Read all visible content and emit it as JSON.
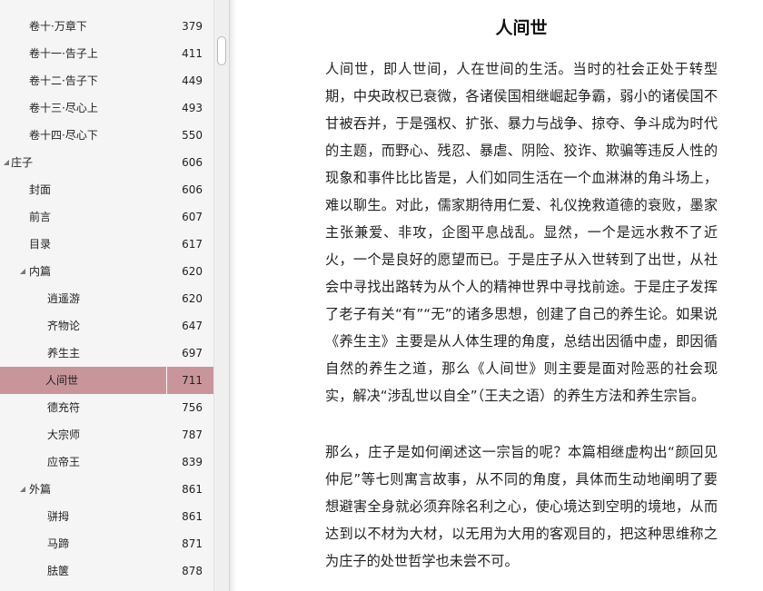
{
  "toc": {
    "items": [
      {
        "label": "卷十·万章下",
        "page": "379",
        "level": 1,
        "arrow": ""
      },
      {
        "label": "卷十一·告子上",
        "page": "411",
        "level": 1,
        "arrow": ""
      },
      {
        "label": "卷十二·告子下",
        "page": "449",
        "level": 1,
        "arrow": ""
      },
      {
        "label": "卷十三·尽心上",
        "page": "493",
        "level": 1,
        "arrow": ""
      },
      {
        "label": "卷十四·尽心下",
        "page": "550",
        "level": 1,
        "arrow": ""
      },
      {
        "label": "庄子",
        "page": "606",
        "level": 0,
        "arrow": "◢"
      },
      {
        "label": "封面",
        "page": "606",
        "level": 1,
        "arrow": ""
      },
      {
        "label": "前言",
        "page": "607",
        "level": 1,
        "arrow": ""
      },
      {
        "label": "目录",
        "page": "617",
        "level": 1,
        "arrow": ""
      },
      {
        "label": "内篇",
        "page": "620",
        "level": 1,
        "arrow": "◢"
      },
      {
        "label": "逍遥游",
        "page": "620",
        "level": 2,
        "arrow": ""
      },
      {
        "label": "齐物论",
        "page": "647",
        "level": 2,
        "arrow": ""
      },
      {
        "label": "养生主",
        "page": "697",
        "level": 2,
        "arrow": ""
      },
      {
        "label": "人间世",
        "page": "711",
        "level": 2,
        "arrow": "",
        "selected": true
      },
      {
        "label": "德充符",
        "page": "756",
        "level": 2,
        "arrow": ""
      },
      {
        "label": "大宗师",
        "page": "787",
        "level": 2,
        "arrow": ""
      },
      {
        "label": "应帝王",
        "page": "839",
        "level": 2,
        "arrow": ""
      },
      {
        "label": "外篇",
        "page": "861",
        "level": 1,
        "arrow": "◢"
      },
      {
        "label": "骈拇",
        "page": "861",
        "level": 2,
        "arrow": ""
      },
      {
        "label": "马蹄",
        "page": "871",
        "level": 2,
        "arrow": ""
      },
      {
        "label": "胠箧",
        "page": "878",
        "level": 2,
        "arrow": ""
      }
    ]
  },
  "content": {
    "title": "人间世",
    "paragraphs": [
      "人间世，即人世间，人在世间的生活。当时的社会正处于转型期，中央政权已衰微，各诸侯国相继崛起争霸，弱小的诸侯国不甘被吞并，于是强权、扩张、暴力与战争、掠夺、争斗成为时代的主题，而野心、残忍、暴虐、阴险、狡诈、欺骗等违反人性的现象和事件比比皆是，人们如同生活在一个血淋淋的角斗场上，难以聊生。对此，儒家期待用仁爱、礼仪挽救道德的衰败，墨家主张兼爱、非攻，企图平息战乱。显然，一个是远水救不了近火，一个是良好的愿望而已。于是庄子从入世转到了出世，从社会中寻找出路转为从个人的精神世界中寻找前途。于是庄子发挥了老子有关“有”“无”的诸多思想，创建了自己的养生论。如果说《养生主》主要是从人体生理的角度，总结出因循中虚，即因循自然的养生之道，那么《人间世》则主要是面对险恶的社会现实，解决“涉乱世以自全”（王夫之语）的养生方法和养生宗旨。",
      "那么，庄子是如何阐述这一宗旨的呢？本篇相继虚构出“颜回见仲尼”等七则寓言故事，从不同的角度，具体而生动地阐明了要想避害全身就必须弃除名利之心，使心境达到空明的境地，从而达到以不材为大材，以无用为大用的客观目的，把这种思维称之为庄子的处世哲学也未尝不可。"
    ]
  }
}
